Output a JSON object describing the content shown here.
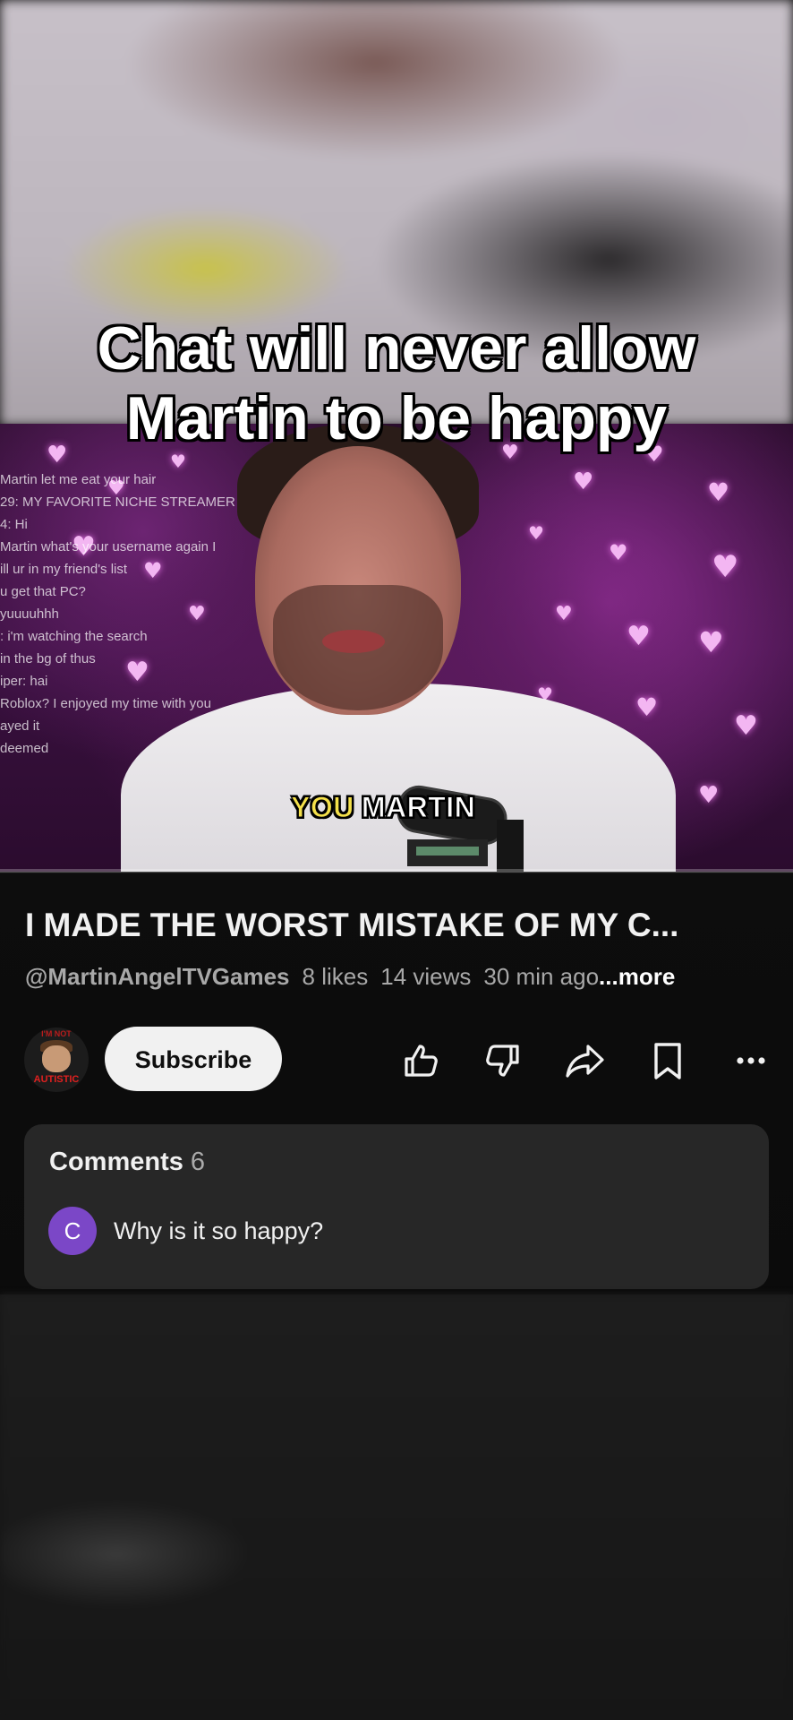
{
  "overlay": {
    "headline": "Chat will never allow Martin to be happy"
  },
  "video": {
    "chat_lines": [
      "Martin let me eat your hair",
      "29: MY FAVORITE NICHE STREAMER",
      "4: Hi",
      "Martin what's your username again I",
      "ill ur in my friend's list",
      "u get that PC?",
      "yuuuuhhh",
      ": i'm watching the search",
      "in the bg of thus",
      "iper: hai",
      "Roblox? I enjoyed my time with you",
      "ayed it",
      "deemed"
    ],
    "caption_highlight": "YOU",
    "caption_text": "MARTIN"
  },
  "details": {
    "title": "I MADE THE WORST MISTAKE OF MY C...",
    "channel": "@MartinAngelTVGames",
    "likes": "8 likes",
    "views": "14 views",
    "time": "30 min ago",
    "more": "...more"
  },
  "channel_avatar": {
    "top_text": "I'M NOT",
    "bottom_text": "AUTISTIC"
  },
  "actions": {
    "subscribe_label": "Subscribe",
    "icons": [
      "like-icon",
      "dislike-icon",
      "share-icon",
      "save-icon",
      "more-icon"
    ]
  },
  "comments": {
    "title": "Comments",
    "count": "6",
    "first": {
      "avatar_letter": "C",
      "avatar_color": "#7b47c7",
      "text": "Why is it so happy?"
    }
  },
  "colors": {
    "panel_bg": "#0d0d0d",
    "card_bg": "#272727",
    "caption_yellow": "#f4e04a",
    "subscribe_bg": "#f1f1f1"
  }
}
